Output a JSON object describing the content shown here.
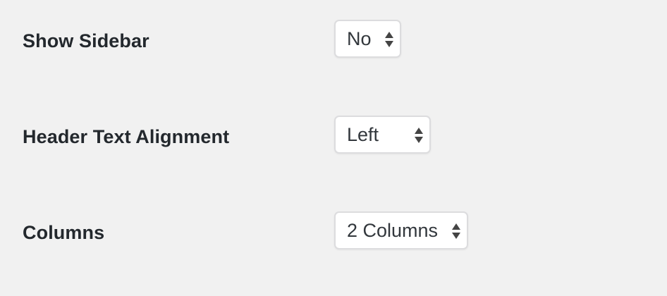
{
  "settings": [
    {
      "label": "Show Sidebar",
      "selected": "No"
    },
    {
      "label": "Header Text Alignment",
      "selected": "Left"
    },
    {
      "label": "Columns",
      "selected": "2 Columns"
    }
  ],
  "icons": {
    "select_arrows": "up-down-arrows-icon"
  },
  "colors": {
    "background": "#f1f1f1",
    "text": "#23282d",
    "select_border": "#dcdcde",
    "select_background": "#ffffff"
  }
}
